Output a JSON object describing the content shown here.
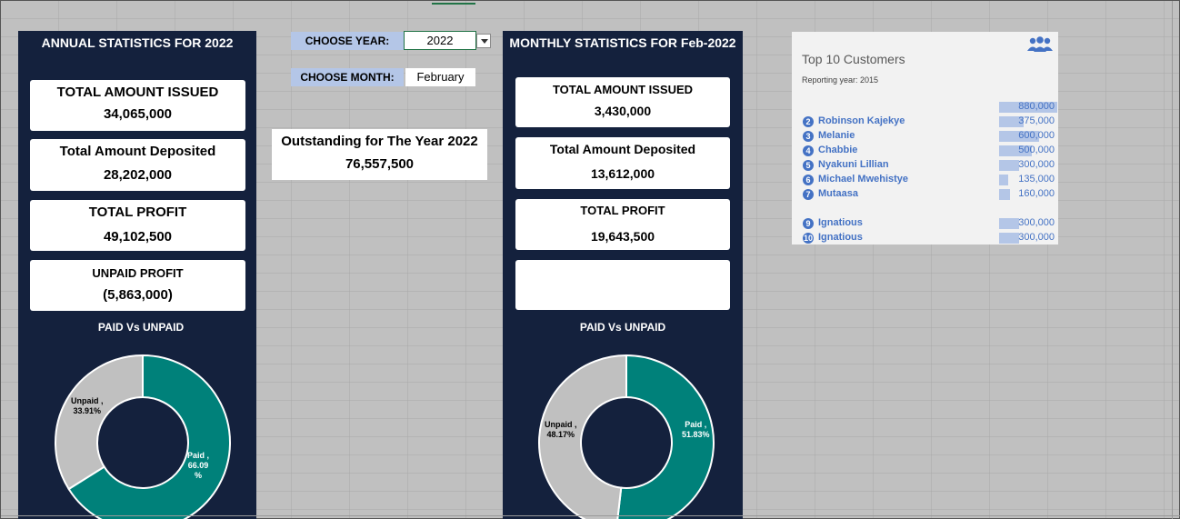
{
  "annual": {
    "title": "ANNUAL STATISTICS FOR 2022",
    "total_issued_label": "TOTAL AMOUNT ISSUED",
    "total_issued_value": "34,065,000",
    "deposited_label": "Total Amount Deposited",
    "deposited_value": "28,202,000",
    "profit_label": "TOTAL PROFIT",
    "profit_value": "49,102,500",
    "unpaid_label": "UNPAID PROFIT",
    "unpaid_value": "(5,863,000)",
    "chart_title": "PAID Vs UNPAID",
    "paid_label": "Paid ,",
    "paid_pct_a": "66.09",
    "paid_pct_b": "%",
    "unpaid_label2": "Unpaid ,",
    "unpaid_pct": "33.91%"
  },
  "selectors": {
    "year_label": "CHOOSE YEAR:",
    "year_value": "2022",
    "month_label": "CHOOSE MONTH:",
    "month_value": "February"
  },
  "outstanding": {
    "label": "Outstanding for The Year 2022",
    "value": "76,557,500"
  },
  "monthly": {
    "title": "MONTHLY STATISTICS FOR Feb-2022",
    "total_issued_label": "TOTAL AMOUNT ISSUED",
    "total_issued_value": "3,430,000",
    "deposited_label": "Total Amount Deposited",
    "deposited_value": "13,612,000",
    "profit_label": "TOTAL PROFIT",
    "profit_value": "19,643,500",
    "chart_title": "PAID Vs UNPAID",
    "paid_label": "Paid ,",
    "paid_pct": "51.83%",
    "unpaid_label": "Unpaid ,",
    "unpaid_pct": "48.17%"
  },
  "customers": {
    "title": "Top 10 Customers",
    "subtitle": "Reporting year: 2015",
    "icon": "people-icon",
    "rows": [
      {
        "rank": "",
        "name": "",
        "value": "880,000",
        "fraction": 1.0
      },
      {
        "rank": "2",
        "name": "Robinson Kajekye",
        "value": "375,000",
        "fraction": 0.426
      },
      {
        "rank": "3",
        "name": "Melanie",
        "value": "600,000",
        "fraction": 0.682
      },
      {
        "rank": "4",
        "name": "Chabbie",
        "value": "500,000",
        "fraction": 0.568
      },
      {
        "rank": "5",
        "name": "Nyakuni Lillian",
        "value": "300,000",
        "fraction": 0.341
      },
      {
        "rank": "6",
        "name": "Michael Mwehistye",
        "value": "135,000",
        "fraction": 0.153
      },
      {
        "rank": "7",
        "name": "Mutaasa",
        "value": "160,000",
        "fraction": 0.182
      },
      {
        "rank": "",
        "name": "",
        "value": "",
        "fraction": 0
      },
      {
        "rank": "9",
        "name": "Ignatious",
        "value": "300,000",
        "fraction": 0.341
      },
      {
        "rank": "10",
        "name": "Ignatious",
        "value": "300,000",
        "fraction": 0.341
      }
    ]
  },
  "chart_data": [
    {
      "type": "pie",
      "title": "PAID Vs UNPAID",
      "categories": [
        "Paid",
        "Unpaid"
      ],
      "values": [
        66.09,
        33.91
      ],
      "colors": [
        "#00817a",
        "#c0c0c0"
      ]
    },
    {
      "type": "pie",
      "title": "PAID Vs UNPAID",
      "categories": [
        "Paid",
        "Unpaid"
      ],
      "values": [
        51.83,
        48.17
      ],
      "colors": [
        "#00817a",
        "#c0c0c0"
      ]
    }
  ],
  "colors": {
    "panel_bg": "#14213d",
    "paid": "#00817a",
    "unpaid": "#c0c0c0",
    "selector_label_bg": "#b4c6e7",
    "customer_accent": "#4472c4"
  }
}
